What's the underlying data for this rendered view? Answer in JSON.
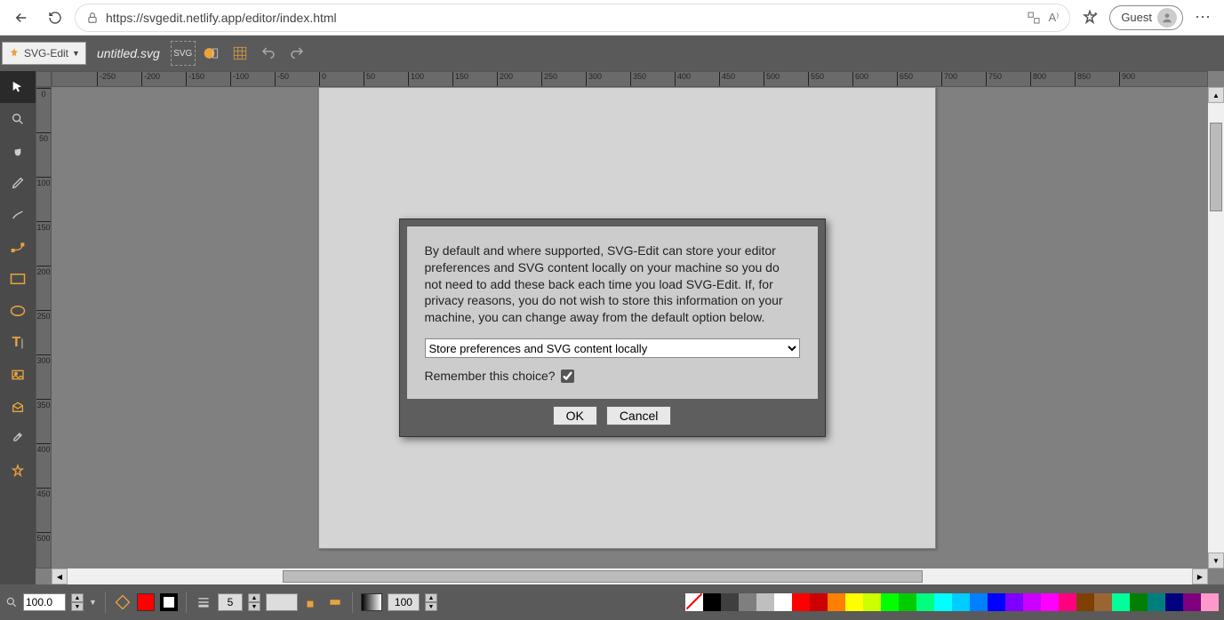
{
  "browser": {
    "url": "https://svgedit.netlify.app/editor/index.html",
    "guest_label": "Guest"
  },
  "topbar": {
    "app_name": "SVG-Edit",
    "file_name": "untitled.svg",
    "svg_label": "SVG"
  },
  "ruler": {
    "h_ticks": [
      -250,
      -200,
      -150,
      -100,
      -50,
      0,
      50,
      100,
      150,
      200,
      250,
      300,
      350,
      400,
      450,
      500,
      550,
      600,
      650,
      700,
      750,
      800,
      850,
      900
    ],
    "v_ticks": [
      0,
      50,
      100,
      150,
      200,
      250,
      300,
      350,
      400,
      450,
      500
    ]
  },
  "bottombar": {
    "zoom": "100.0",
    "stroke_width": "5",
    "opacity": "100",
    "fill_color": "#ff0000",
    "stroke_color": "#000000"
  },
  "palette": [
    "none",
    "#000000",
    "#3f3f3f",
    "#7f7f7f",
    "#bfbfbf",
    "#ffffff",
    "#ff0000",
    "#cc0000",
    "#ff7f00",
    "#ffff00",
    "#ccff00",
    "#00ff00",
    "#00cc00",
    "#00ff7f",
    "#00ffff",
    "#00ccff",
    "#007fff",
    "#0000ff",
    "#7f00ff",
    "#cc00ff",
    "#ff00ff",
    "#ff007f",
    "#7f3f00",
    "#996633",
    "#00ff99",
    "#007f00",
    "#007f7f",
    "#00007f",
    "#7f007f",
    "#ff99cc"
  ],
  "dialog": {
    "message": "By default and where supported, SVG-Edit can store your editor preferences and SVG content locally on your machine so you do not need to add these back each time you load SVG-Edit. If, for privacy reasons, you do not wish to store this information on your machine, you can change away from the default option below.",
    "select_option": "Store preferences and SVG content locally",
    "remember_label": "Remember this choice?",
    "ok": "OK",
    "cancel": "Cancel"
  }
}
